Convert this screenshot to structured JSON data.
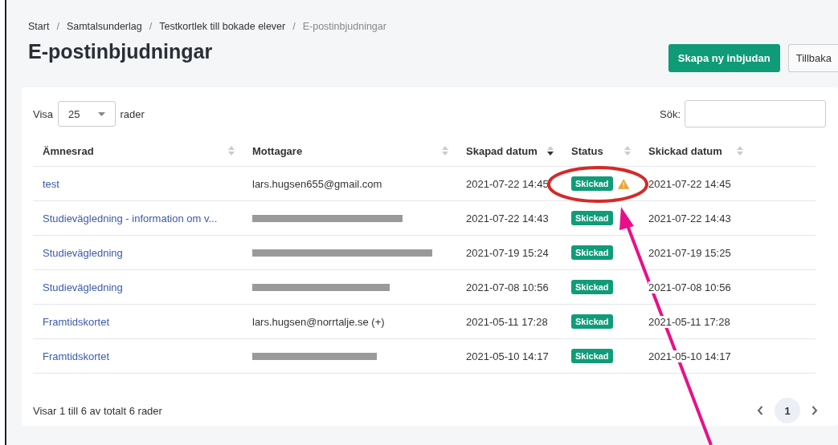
{
  "breadcrumb": [
    {
      "label": "Start",
      "current": false
    },
    {
      "separator": "/",
      "label": "Samtalsunderlag",
      "current": false
    },
    {
      "separator": "/",
      "label": "Testkortlek till bokade elever",
      "current": false
    },
    {
      "separator": "/",
      "label": "E-postinbjudningar",
      "current": true
    }
  ],
  "title": "E-postinbjudningar",
  "buttons": [
    {
      "label": "Skapa ny inbjudan",
      "kind": "primary"
    },
    {
      "label": "Tillbaka",
      "kind": "secondary"
    }
  ],
  "length_menu": {
    "prefix": "Visa",
    "value": "25",
    "suffix": "rader"
  },
  "search": {
    "label": "Sök:"
  },
  "table": {
    "columns": [
      {
        "label": "Ämnesrad",
        "sorted": false
      },
      {
        "label": "Mottagare",
        "sorted": false
      },
      {
        "label": "Skapad datum",
        "sorted": true
      },
      {
        "label": "Status",
        "sorted": false
      },
      {
        "label": "Skickad datum",
        "sorted": false
      }
    ],
    "rows": [
      {
        "subject": "test",
        "recipient": "lars.hugsen655@gmail.com",
        "redacted": false,
        "created": "2021-07-22 14:45",
        "status": "Skickad",
        "warning": true,
        "sent": "2021-07-22 14:45"
      },
      {
        "subject": "Studievägledning - information om v...",
        "redacted": true,
        "created": "2021-07-22 14:43",
        "status": "Skickad",
        "warning": false,
        "sent": "2021-07-22 14:43"
      },
      {
        "subject": "Studievägledning",
        "redacted": true,
        "created": "2021-07-19 15:24",
        "status": "Skickad",
        "warning": false,
        "sent": "2021-07-19 15:25"
      },
      {
        "subject": "Studievägledning",
        "redacted": true,
        "created": "2021-07-08 10:56",
        "status": "Skickad",
        "warning": false,
        "sent": "2021-07-08 10:56"
      },
      {
        "subject": "Framtidskortet",
        "recipient": "lars.hugsen@norrtalje.se (+)",
        "redacted": false,
        "created": "2021-05-11 17:28",
        "status": "Skickad",
        "warning": false,
        "sent": "2021-05-11 17:28"
      },
      {
        "subject": "Framtidskortet",
        "redacted": true,
        "created": "2021-05-10 14:17",
        "status": "Skickad",
        "warning": false,
        "sent": "2021-05-10 14:17"
      }
    ]
  },
  "footer": {
    "info": "Visar 1 till 6 av totalt 6 rader",
    "pages": [
      {
        "label": "1",
        "selected": true
      }
    ]
  }
}
